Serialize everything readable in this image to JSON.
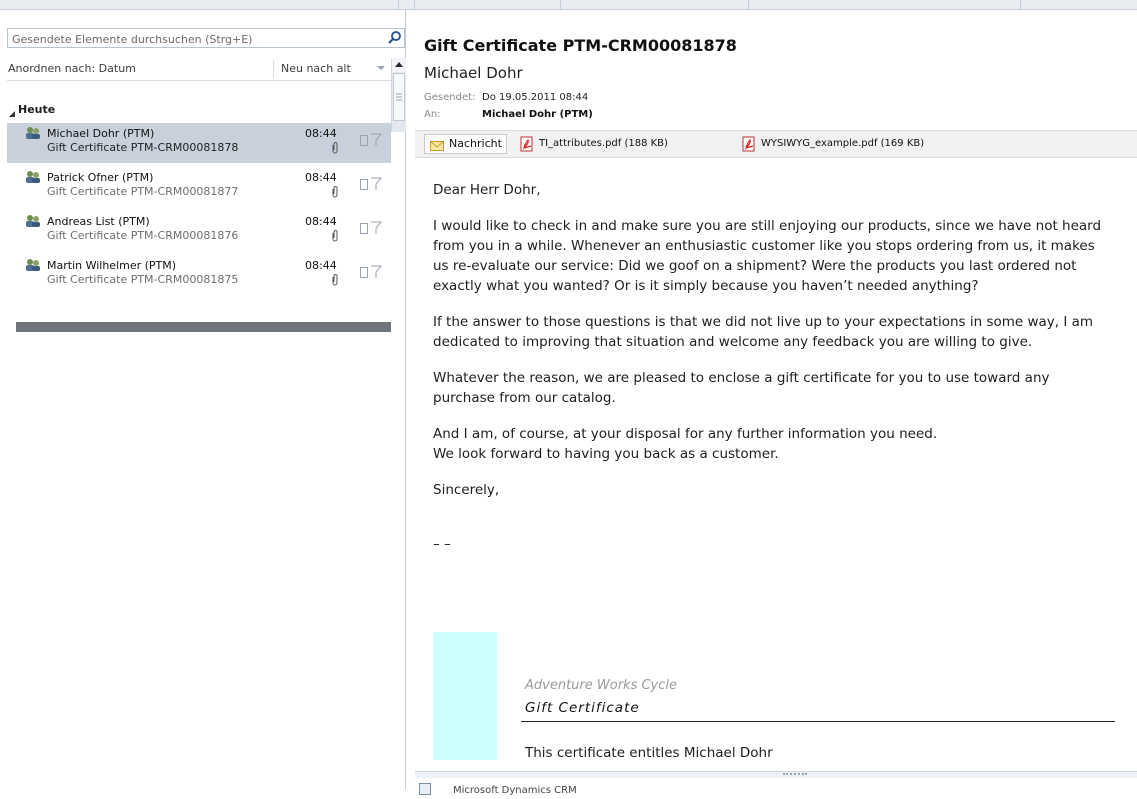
{
  "search": {
    "placeholder": "Gesendete Elemente durchsuchen (Strg+E)"
  },
  "sortbar": {
    "arrange_by": "Anordnen nach: Datum",
    "order": "Neu nach alt"
  },
  "group": {
    "label": "Heute"
  },
  "messages": [
    {
      "sender": "Michael Dohr (PTM)",
      "subject": "Gift Certificate PTM-CRM00081878",
      "time": "08:44",
      "selected": true
    },
    {
      "sender": "Patrick Ofner (PTM)",
      "subject": "Gift Certificate PTM-CRM00081877",
      "time": "08:44",
      "selected": false
    },
    {
      "sender": "Andreas List (PTM)",
      "subject": "Gift Certificate PTM-CRM00081876",
      "time": "08:44",
      "selected": false
    },
    {
      "sender": "Martin Wilhelmer (PTM)",
      "subject": "Gift Certificate PTM-CRM00081875",
      "time": "08:44",
      "selected": false
    }
  ],
  "reading": {
    "subject": "Gift Certificate PTM-CRM00081878",
    "from": "Michael Dohr",
    "sent_label": "Gesendet:",
    "sent_value": "Do 19.05.2011 08:44",
    "to_label": "An:",
    "to_value": "Michael Dohr (PTM)",
    "message_tab": "Nachricht",
    "attachments": [
      {
        "name": "TI_attributes.pdf (188 KB)"
      },
      {
        "name": "WYSIWYG_example.pdf (169 KB)"
      }
    ],
    "body": {
      "greeting": "Dear Herr  Dohr,",
      "p1": "I would like to check in and make sure you are still enjoying our products, since we have not heard\nfrom you in a while.  Whenever an enthusiastic customer like you stops ordering from us, it makes\nus re-evaluate our service: Did we goof on a shipment? Were the products you last ordered not\nexactly what you wanted? Or is it simply because you haven’t needed anything?",
      "p2": "If the answer to those questions is that we did not live up to your expectations in some way, I am\ndedicated to improving that situation and welcome any feedback you are willing to give.",
      "p3": "Whatever the reason, we are pleased to enclose a gift certificate for you to use toward any\npurchase from our catalog.",
      "p4": "And I am, of course, at your disposal for any further information you need.\nWe look forward to having you back as a customer.",
      "closing": "Sincerely,",
      "signature": "– –"
    },
    "certificate": {
      "company": "Adventure Works Cycle",
      "title": "Gift Certificate",
      "line": "This certificate entitles Michael Dohr",
      "swatch_color": "#ccfdff"
    },
    "footer_label": "Microsoft Dynamics CRM"
  }
}
